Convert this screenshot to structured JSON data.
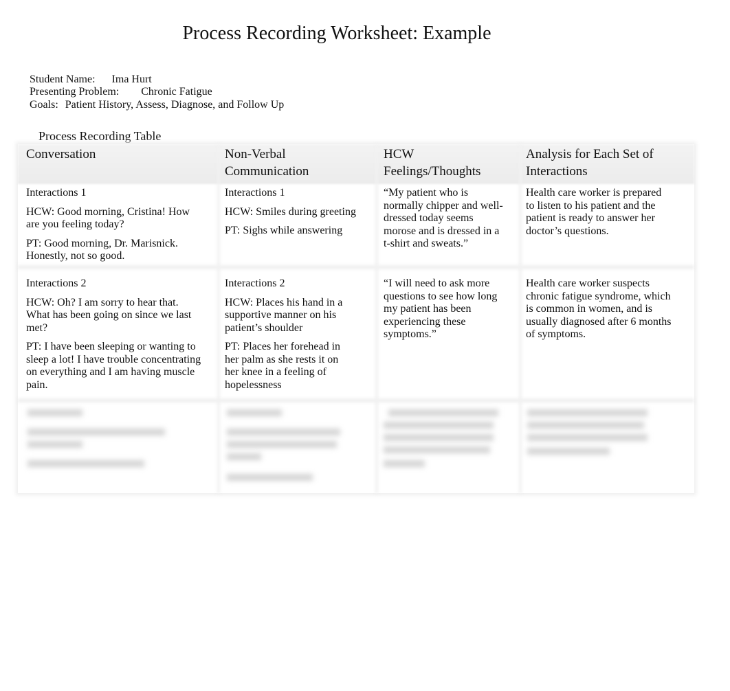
{
  "title": "Process Recording Worksheet: Example",
  "meta": {
    "student_label": "Student Name:",
    "student_value": "Ima Hurt",
    "problem_label": "Presenting Problem:",
    "problem_value": "Chronic Fatigue",
    "goals_label": "Goals:",
    "goals_value": "Patient History, Assess, Diagnose, and Follow Up"
  },
  "table": {
    "caption": "Process Recording Table",
    "headers": [
      "Conversation",
      "Non-Verbal Communication",
      "HCW Feelings/Thoughts",
      "Analysis for Each Set of Interactions"
    ],
    "rows": [
      {
        "conversation": [
          "Interactions 1",
          "HCW: Good morning, Cristina! How are you feeling today?",
          "PT: Good morning, Dr. Marisnick. Honestly, not so good."
        ],
        "nonverbal": [
          "Interactions 1",
          "HCW: Smiles during greeting",
          "PT: Sighs while answering"
        ],
        "feelings": "“My patient who is normally chipper and well-dressed today seems morose and is dressed in a t-shirt and sweats.”",
        "analysis": "Health care worker is prepared to listen to his patient and the patient is ready to answer her doctor’s questions."
      },
      {
        "conversation": [
          "Interactions 2",
          "HCW: Oh? I am sorry to hear that. What has been going on since we last met?",
          "PT: I have been sleeping or wanting to sleep a lot! I have trouble concentrating on everything and I am having muscle pain."
        ],
        "nonverbal": [
          "Interactions 2",
          "HCW: Places his hand in a supportive manner on his patient’s shoulder",
          "PT: Places her forehead in her palm as she rests it on her knee in a feeling of hopelessness"
        ],
        "feelings": "“I will need to ask more questions to see how long my patient has been experiencing these symptoms.”",
        "analysis": "Health care worker suspects chronic fatigue syndrome, which is common in women, and is usually diagnosed after 6 months of symptoms."
      }
    ]
  }
}
